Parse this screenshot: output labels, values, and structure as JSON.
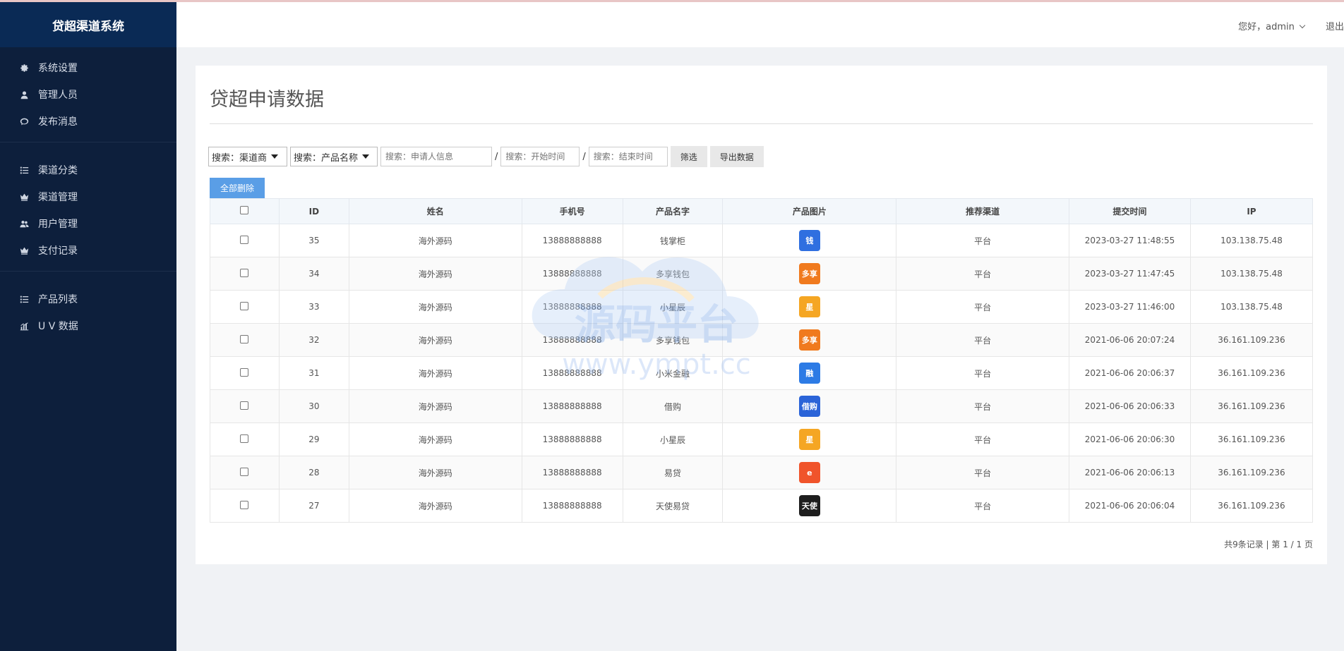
{
  "brand": "贷超渠道系统",
  "header": {
    "greeting": "您好，admin",
    "logout": "退出"
  },
  "sidebar": {
    "group1": [
      {
        "label": "系统设置",
        "icon": "gear-icon"
      },
      {
        "label": "管理人员",
        "icon": "user-icon"
      },
      {
        "label": "发布消息",
        "icon": "chat-icon"
      }
    ],
    "group2": [
      {
        "label": "渠道分类",
        "icon": "list-icon"
      },
      {
        "label": "渠道管理",
        "icon": "crown-icon"
      },
      {
        "label": "用户管理",
        "icon": "users-icon"
      },
      {
        "label": "支付记录",
        "icon": "crown-icon"
      }
    ],
    "group3": [
      {
        "label": "产品列表",
        "icon": "list-icon"
      },
      {
        "label": "U V 数据",
        "icon": "chart-icon"
      }
    ]
  },
  "page": {
    "title": "贷超申请数据"
  },
  "filters": {
    "channel_select": "搜索：渠道商",
    "product_select": "搜索：产品名称",
    "applicant_placeholder": "搜索：申请人信息",
    "start_placeholder": "搜索：开始时间",
    "end_placeholder": "搜索：结束时间",
    "separator": "/",
    "filter_button": "筛选",
    "export_button": "导出数据",
    "delete_all_button": "全部删除"
  },
  "table": {
    "headers": [
      "ID",
      "姓名",
      "手机号",
      "产品名字",
      "产品图片",
      "推荐渠道",
      "提交时间",
      "IP"
    ],
    "rows": [
      {
        "id": "35",
        "name": "海外源码",
        "phone": "13888888888",
        "product": "钱掌柜",
        "img_text": "钱",
        "img_color": "#2f6fe0",
        "channel": "平台",
        "time": "2023-03-27 11:48:55",
        "ip": "103.138.75.48"
      },
      {
        "id": "34",
        "name": "海外源码",
        "phone": "13888888888",
        "product": "多享钱包",
        "img_text": "多享",
        "img_color": "#f07a1e",
        "channel": "平台",
        "time": "2023-03-27 11:47:45",
        "ip": "103.138.75.48"
      },
      {
        "id": "33",
        "name": "海外源码",
        "phone": "13888888888",
        "product": "小星辰",
        "img_text": "星",
        "img_color": "#f5a623",
        "channel": "平台",
        "time": "2023-03-27 11:46:00",
        "ip": "103.138.75.48"
      },
      {
        "id": "32",
        "name": "海外源码",
        "phone": "13888888888",
        "product": "多享钱包",
        "img_text": "多享",
        "img_color": "#f07a1e",
        "channel": "平台",
        "time": "2021-06-06 20:07:24",
        "ip": "36.161.109.236"
      },
      {
        "id": "31",
        "name": "海外源码",
        "phone": "13888888888",
        "product": "小米金融",
        "img_text": "融",
        "img_color": "#2d7be5",
        "channel": "平台",
        "time": "2021-06-06 20:06:37",
        "ip": "36.161.109.236"
      },
      {
        "id": "30",
        "name": "海外源码",
        "phone": "13888888888",
        "product": "借购",
        "img_text": "借购",
        "img_color": "#2b64d8",
        "channel": "平台",
        "time": "2021-06-06 20:06:33",
        "ip": "36.161.109.236"
      },
      {
        "id": "29",
        "name": "海外源码",
        "phone": "13888888888",
        "product": "小星辰",
        "img_text": "星",
        "img_color": "#f5a623",
        "channel": "平台",
        "time": "2021-06-06 20:06:30",
        "ip": "36.161.109.236"
      },
      {
        "id": "28",
        "name": "海外源码",
        "phone": "13888888888",
        "product": "易贷",
        "img_text": "e",
        "img_color": "#f0542b",
        "channel": "平台",
        "time": "2021-06-06 20:06:13",
        "ip": "36.161.109.236"
      },
      {
        "id": "27",
        "name": "海外源码",
        "phone": "13888888888",
        "product": "天使易贷",
        "img_text": "天使",
        "img_color": "#1e1e1e",
        "channel": "平台",
        "time": "2021-06-06 20:06:04",
        "ip": "36.161.109.236"
      }
    ]
  },
  "pager": {
    "text": "共9条记录 | 第 1 / 1 页"
  },
  "watermark": {
    "title": "源码平台",
    "url": "www.ympt.cc"
  }
}
